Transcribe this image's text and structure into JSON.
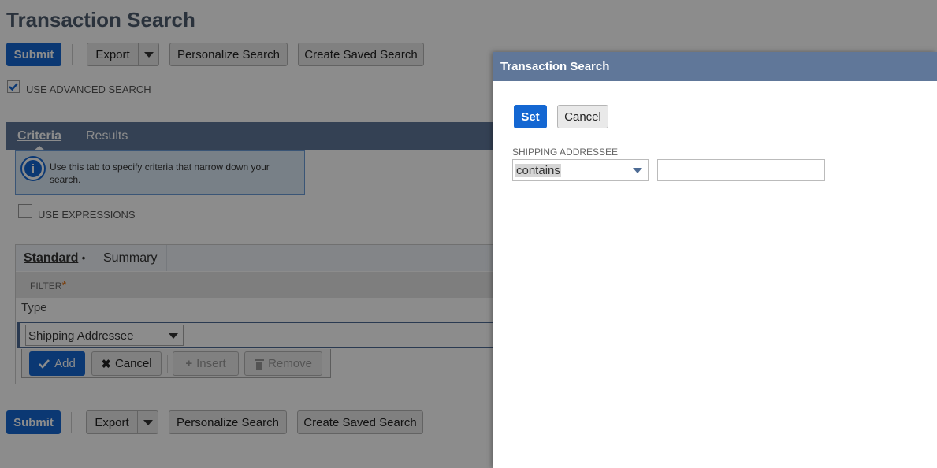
{
  "page": {
    "title": "Transaction Search",
    "submit_label": "Submit",
    "export_label": "Export",
    "personalize_label": "Personalize Search",
    "create_saved_label": "Create Saved Search",
    "use_advanced_label": "USE ADVANCED SEARCH",
    "use_advanced_checked": true
  },
  "tabs": {
    "criteria": "Criteria",
    "results": "Results"
  },
  "info": {
    "text": "Use this tab to specify criteria that narrow down your search."
  },
  "use_expressions_label": "USE EXPRESSIONS",
  "subtabs": {
    "standard": "Standard",
    "standard_marker": "•",
    "summary": "Summary"
  },
  "filter": {
    "header": "FILTER",
    "required_mark": "*",
    "row_label": "Type",
    "selected_value": "Shipping Addressee"
  },
  "row_actions": {
    "add": "Add",
    "cancel": "Cancel",
    "insert": "Insert",
    "remove": "Remove"
  },
  "dialog": {
    "title": "Transaction Search",
    "set_label": "Set",
    "cancel_label": "Cancel",
    "field_label": "SHIPPING ADDRESSEE",
    "operator_value": "contains",
    "text_value": ""
  },
  "colors": {
    "primary": "#1467d2",
    "tab_bar": "#607799",
    "dialog_header": "#607799"
  }
}
